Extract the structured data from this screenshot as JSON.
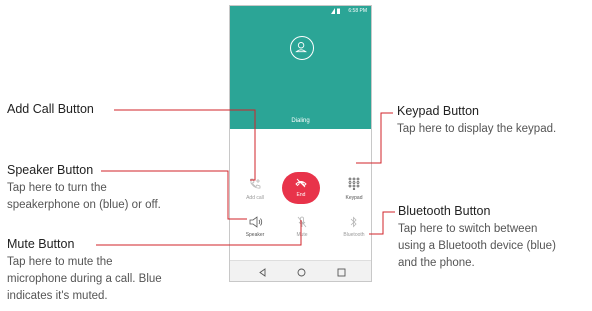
{
  "colors": {
    "teal": "#2ba596",
    "red": "#e8334a",
    "callout_line": "#d2232a"
  },
  "phone": {
    "status_time": "6:58 PM",
    "dialing_label": "Dialing",
    "buttons": {
      "add_call": "Add call",
      "end": "End",
      "keypad": "Keypad",
      "speaker": "Speaker",
      "mute": "Mute",
      "bluetooth": "Bluetooth"
    }
  },
  "callouts": {
    "add_call": {
      "title": "Add Call Button"
    },
    "speaker": {
      "title": "Speaker Button",
      "lines": [
        "Tap here to turn the",
        "speakerphone on (blue) or off."
      ]
    },
    "mute": {
      "title": "Mute Button",
      "lines": [
        "Tap here to mute the",
        "microphone during a call. Blue",
        "indicates it's muted."
      ]
    },
    "keypad": {
      "title": "Keypad Button",
      "lines": [
        "Tap here to display the keypad."
      ]
    },
    "bluetooth": {
      "title": "Bluetooth Button",
      "lines": [
        "Tap here to switch between",
        "using a Bluetooth device (blue)",
        "and the phone."
      ]
    }
  }
}
